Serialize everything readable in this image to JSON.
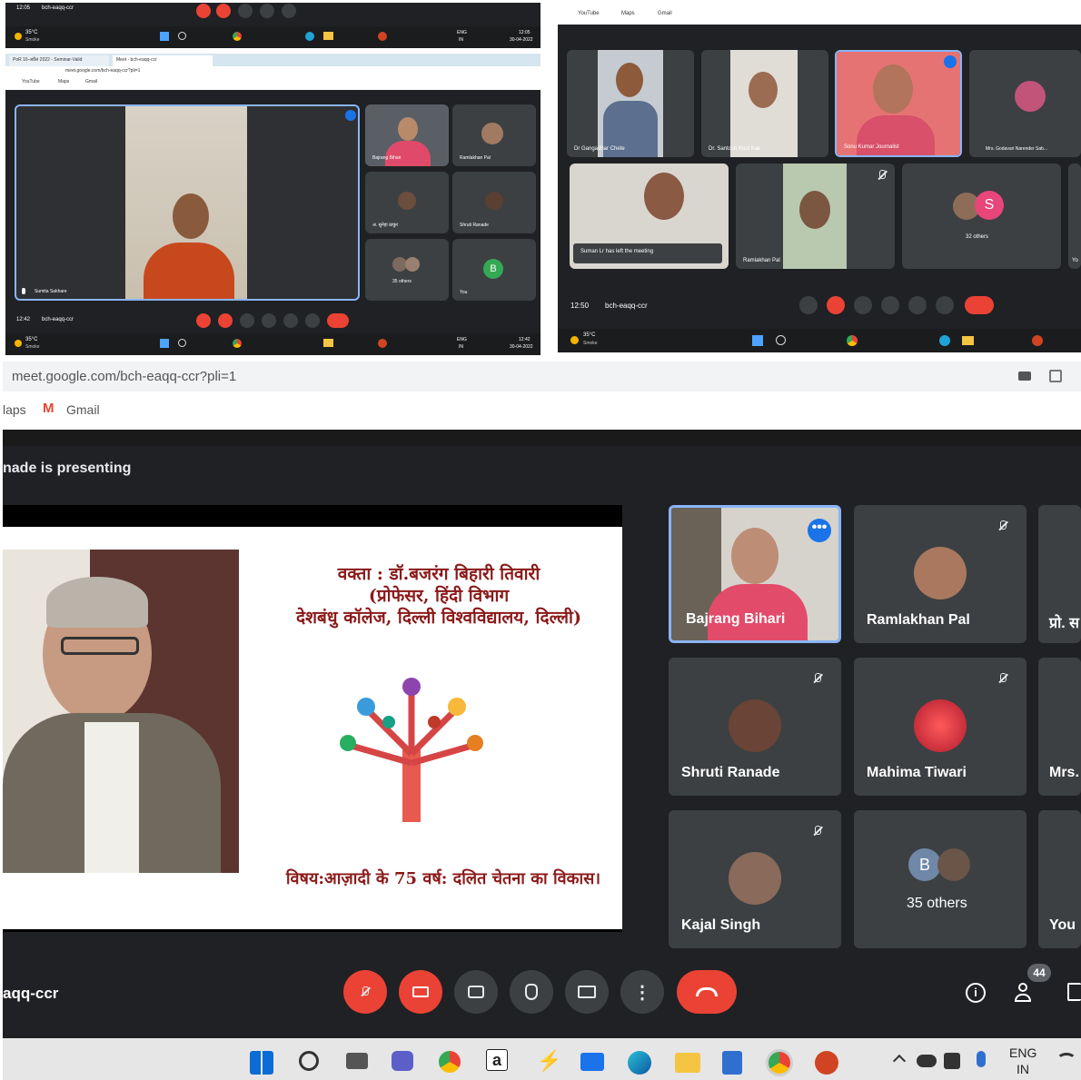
{
  "top_left": {
    "top_strip": {
      "time": "12:05",
      "meeting": "bch-eaqq-ccr",
      "weather_temp": "35°C",
      "weather_desc": "Smoke",
      "lang": "ENG",
      "lang2": "IN",
      "clock_time": "12:05",
      "clock_date": "30-04-2022"
    },
    "tabs": [
      {
        "label": "PoR 16-अप्रैल 2022 - Seminar-Valid"
      },
      {
        "label": "Meet - bch-eaqq-ccr"
      }
    ],
    "url": "meet.google.com/bch-eaqq-ccr?pli=1",
    "bookmarks": [
      "YouTube",
      "Maps",
      "Gmail"
    ],
    "main_tile_name": "Sumita Sakhare",
    "tiles": [
      {
        "name": "Bajrang Bihari"
      },
      {
        "name": "Ramlakhan Pal"
      },
      {
        "name": "अ. सुनेहा ठाकुर"
      },
      {
        "name": "Shruti Ranade"
      },
      {
        "name": "35 others"
      },
      {
        "name": "You",
        "initial": "B"
      }
    ],
    "bottom": {
      "time": "12:42",
      "meeting": "bch-eaqq-ccr",
      "weather_temp": "35°C",
      "weather_desc": "Smoke",
      "lang": "ENG",
      "lang2": "IN",
      "clock_time": "12:42",
      "clock_date": "30-04-2022"
    }
  },
  "top_right": {
    "bookmarks": [
      "YouTube",
      "Maps",
      "Gmail"
    ],
    "tiles": [
      {
        "name": "Dr Gangadhar Chete"
      },
      {
        "name": "Dr. Santosh Koul Kak"
      },
      {
        "name": "Sonu Kumar Journalist"
      },
      {
        "name": "Mrs. Godavari Narender Sab..."
      },
      {
        "name": "Suman Lr has left the meeting"
      },
      {
        "name": "Ramlakhan Pal"
      },
      {
        "name": "32 others",
        "initial": "S"
      },
      {
        "name": "Yo"
      }
    ],
    "bottom": {
      "time": "12:50",
      "meeting": "bch-eaqq-ccr",
      "weather_temp": "35°C",
      "weather_desc": "Smoke"
    }
  },
  "big": {
    "url": "meet.google.com/bch-eaqq-ccr?pli=1",
    "bookmarks": [
      "laps",
      "Gmail"
    ],
    "presenting": "nade is presenting",
    "slide": {
      "line1": "वक्ता : डॉ.बजरंग बिहारी तिवारी",
      "line2": "(प्रोफेसर, हिंदी विभाग",
      "line3": "देशबंधु कॉलेज, दिल्ली विश्वविद्यालय, दिल्ली)",
      "topic": "विषय:आज़ादी के 75 वर्ष: दलित चेतना का विकास।"
    },
    "tiles": [
      {
        "name": "Bajrang Bihari"
      },
      {
        "name": "Ramlakhan Pal"
      },
      {
        "name": "प्रो. स"
      },
      {
        "name": "Shruti Ranade"
      },
      {
        "name": "Mahima Tiwari"
      },
      {
        "name": "Mrs."
      },
      {
        "name": "Kajal Singh"
      },
      {
        "name": "35 others",
        "initial": "B"
      },
      {
        "name": "You"
      }
    ],
    "meeting": "aqq-ccr",
    "participant_count": "44",
    "lang": "ENG",
    "lang2": "IN"
  },
  "colors": {
    "meet_bg": "#202124",
    "tile_bg": "#3c4043",
    "end_call": "#ea4335",
    "active_border": "#8ab4f8",
    "slide_text": "#8b1a1a"
  }
}
